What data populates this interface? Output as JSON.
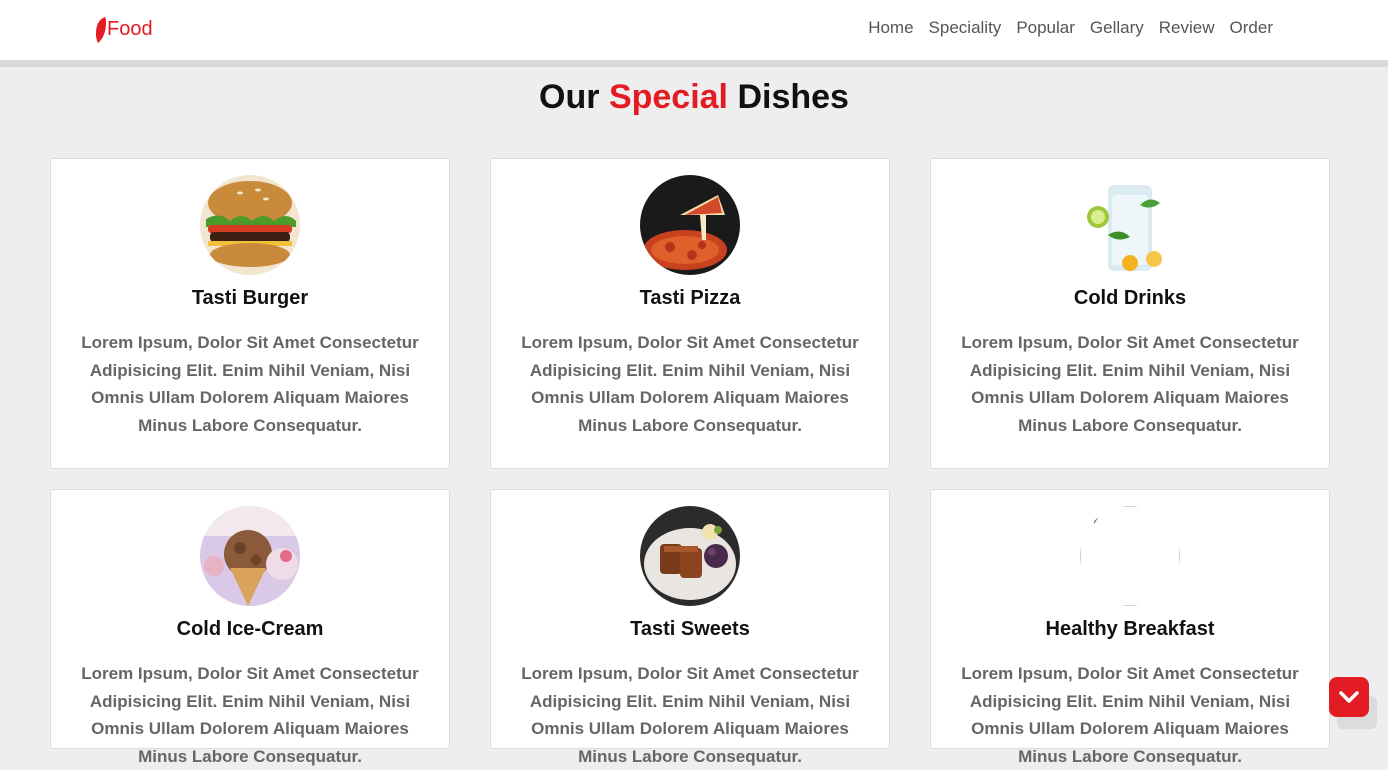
{
  "header": {
    "logo_text": "Food",
    "nav": [
      "Home",
      "Speciality",
      "Popular",
      "Gellary",
      "Review",
      "Order"
    ]
  },
  "heading": {
    "part1": "Our ",
    "accent": "Special",
    "part2": " Dishes"
  },
  "dishes": [
    {
      "title": "Tasti Burger",
      "image": "burger-image",
      "desc": "Lorem Ipsum, Dolor Sit Amet Consectetur Adipisicing Elit. Enim Nihil Veniam, Nisi Omnis Ullam Dolorem Aliquam Maiores Minus Labore Consequatur."
    },
    {
      "title": "Tasti Pizza",
      "image": "pizza-image",
      "desc": "Lorem Ipsum, Dolor Sit Amet Consectetur Adipisicing Elit. Enim Nihil Veniam, Nisi Omnis Ullam Dolorem Aliquam Maiores Minus Labore Consequatur."
    },
    {
      "title": "Cold Drinks",
      "image": "drinks-image",
      "desc": "Lorem Ipsum, Dolor Sit Amet Consectetur Adipisicing Elit. Enim Nihil Veniam, Nisi Omnis Ullam Dolorem Aliquam Maiores Minus Labore Consequatur."
    },
    {
      "title": "Cold Ice-Cream",
      "image": "ice-cream-image",
      "desc": "Lorem Ipsum, Dolor Sit Amet Consectetur Adipisicing Elit. Enim Nihil Veniam, Nisi Omnis Ullam Dolorem Aliquam Maiores Minus Labore Consequatur."
    },
    {
      "title": "Tasti Sweets",
      "image": "sweets-image",
      "desc": "Lorem Ipsum, Dolor Sit Amet Consectetur Adipisicing Elit. Enim Nihil Veniam, Nisi Omnis Ullam Dolorem Aliquam Maiores Minus Labore Consequatur."
    },
    {
      "title": "Healthy Breakfast",
      "image": "breakfast-image",
      "desc": "Lorem Ipsum, Dolor Sit Amet Consectetur Adipisicing Elit. Enim Nihil Veniam, Nisi Omnis Ullam Dolorem Aliquam Maiores Minus Labore Consequatur."
    }
  ],
  "colors": {
    "accent": "#e31b23",
    "background": "#eeeeee",
    "card": "#ffffff",
    "text_muted": "#666666"
  },
  "scroll_button": {
    "icon": "chevron-down-icon"
  }
}
